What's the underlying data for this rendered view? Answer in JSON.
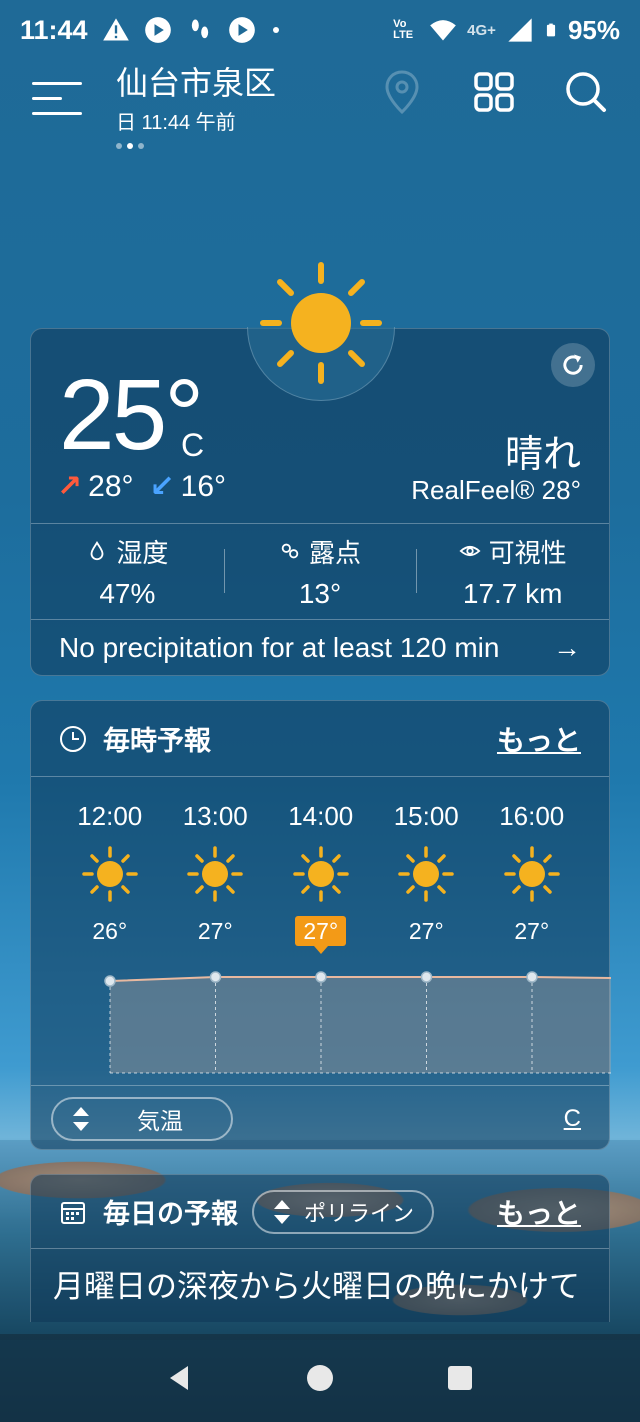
{
  "status_bar": {
    "time": "11:44",
    "volte": "Vo LTE",
    "network": "4G+",
    "battery": "95%"
  },
  "header": {
    "city": "仙台市泉区",
    "datetime": "日 11:44 午前",
    "page_dots": 3,
    "active_dot": 2
  },
  "current": {
    "temperature": "25°",
    "unit": "C",
    "high": "28°",
    "low": "16°",
    "condition": "晴れ",
    "realfeel": "RealFeel® 28°",
    "stats": [
      {
        "label": "湿度",
        "value": "47%",
        "icon": "droplet-icon"
      },
      {
        "label": "露点",
        "value": "13°",
        "icon": "dewpoint-icon"
      },
      {
        "label": "可視性",
        "value": "17.7 km",
        "icon": "eye-icon"
      }
    ],
    "precipitation": "No precipitation for at least 120 min"
  },
  "hourly": {
    "title": "毎時予報",
    "more": "もっと",
    "hours": [
      {
        "time": "12:00",
        "temp": "26°",
        "icon": "sun-icon",
        "value": 26
      },
      {
        "time": "13:00",
        "temp": "27°",
        "icon": "sun-icon",
        "value": 27
      },
      {
        "time": "14:00",
        "temp": "27°",
        "icon": "sun-icon",
        "value": 27,
        "highlight": true
      },
      {
        "time": "15:00",
        "temp": "27°",
        "icon": "sun-icon",
        "value": 27
      },
      {
        "time": "16:00",
        "temp": "27°",
        "icon": "sun-icon",
        "value": 27
      }
    ],
    "toggle_label": "気温",
    "unit": "C"
  },
  "daily": {
    "title": "毎日の予報",
    "toggle_label": "ポリライン",
    "more": "もっと",
    "summary": "月曜日の深夜から火曜日の晩にかけて"
  },
  "colors": {
    "accent": "#f39a17",
    "sun": "#f5b21f",
    "high_arrow": "#ff5a3c",
    "low_arrow": "#4aa3ff"
  }
}
